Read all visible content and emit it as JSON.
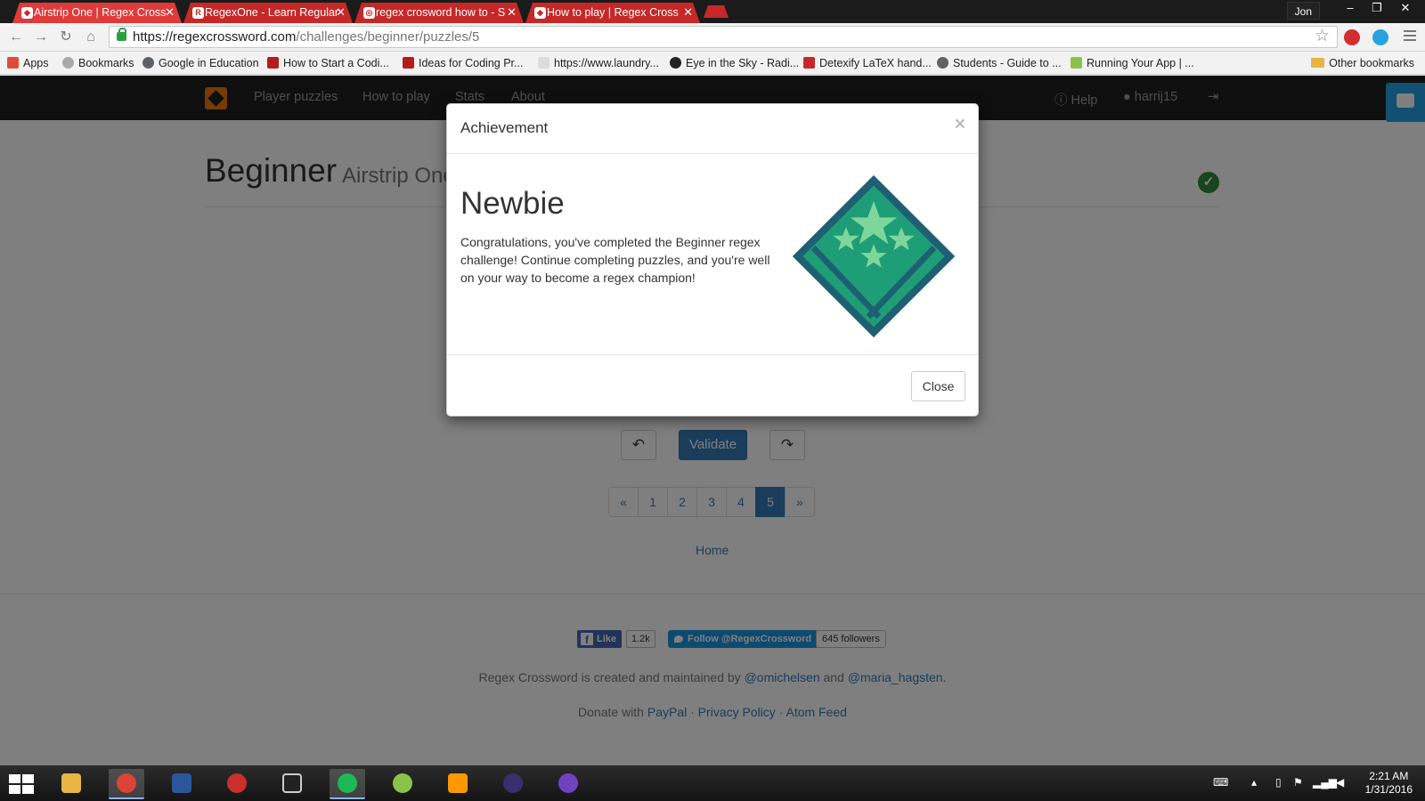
{
  "browser": {
    "tabs": [
      {
        "title": "Airstrip One | Regex Cross",
        "active": true
      },
      {
        "title": "RegexOne - Learn Regular",
        "active": false
      },
      {
        "title": "regex crosword how to - S",
        "active": false
      },
      {
        "title": "How to play | Regex Cross",
        "active": false
      }
    ],
    "user": "Jon",
    "url_host": "https://regexcrossword.com",
    "url_path": "/challenges/beginner/puzzles/5",
    "bookmarks": [
      "Apps",
      "Bookmarks",
      "Google in Education",
      "How to Start a Codi...",
      "Ideas for Coding Pr...",
      "https://www.laundry...",
      "Eye in the Sky - Radi...",
      "Detexify LaTeX hand...",
      "Students - Guide to ...",
      "Running Your App | ..."
    ],
    "other_bookmarks": "Other bookmarks"
  },
  "site": {
    "nav": [
      "Player puzzles",
      "How to play",
      "Stats",
      "About"
    ],
    "help": "Help",
    "username": "harrij15",
    "title": "Beginner",
    "subtitle": "Airstrip One",
    "validate_label": "Validate",
    "pager": [
      "«",
      "1",
      "2",
      "3",
      "4",
      "5",
      "»"
    ],
    "pager_active": "5",
    "home_label": "Home"
  },
  "footer": {
    "fb_like": "Like",
    "fb_count": "1.2k",
    "tw_follow": "Follow @RegexCrossword",
    "tw_count": "645 followers",
    "credit_prefix": "Regex Crossword is created and maintained by",
    "author1": "@omichelsen",
    "credit_and": "and",
    "author2": "@maria_hagsten",
    "donate_prefix": "Donate with",
    "paypal": "PayPal",
    "privacy": "Privacy Policy",
    "atom": "Atom Feed"
  },
  "modal": {
    "title": "Achievement",
    "close_x": "×",
    "achievement_name": "Newbie",
    "achievement_text": "Congratulations, you've completed the Beginner regex challenge! Continue completing puzzles, and you're well on your way to become a regex champion!",
    "close_label": "Close"
  },
  "taskbar": {
    "time": "2:21 AM",
    "date": "1/31/2016"
  },
  "colors": {
    "tab_red": "#c62828",
    "primary": "#337ab7",
    "badge_teal": "#1e5f72",
    "badge_green": "#1e9e77",
    "star_green": "#7ed69a"
  }
}
